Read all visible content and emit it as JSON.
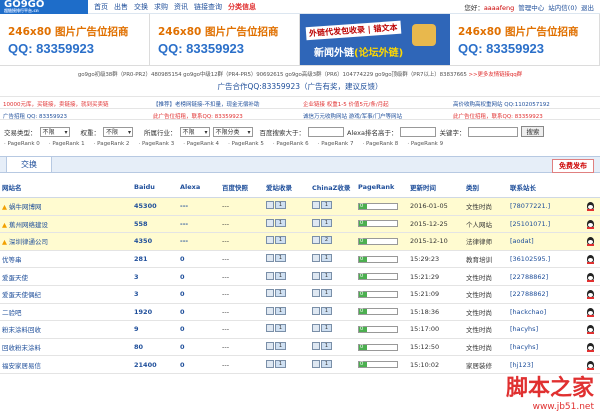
{
  "logo": {
    "text": "GO9GO",
    "sub": "超链接排行平台.cn"
  },
  "nav": [
    "首页",
    "出售",
    "交换",
    "求购",
    "资讯",
    "链接查询",
    "分类信息"
  ],
  "user": {
    "label": "您好：",
    "name": "aaaafeng",
    "center": "管理中心",
    "msg": "站内信(0)",
    "exit": "退出"
  },
  "ads": [
    {
      "title": "246x80 图片广告位招商",
      "qq": "QQ: 83359923"
    },
    {
      "title": "246x80 图片广告位招商",
      "qq": "QQ: 83359923"
    },
    {
      "line1": "外链代发包收录 | 锚文本",
      "line2": "新闻外链",
      "line2b": "(论坛外链)"
    },
    {
      "title": "246x80 图片广告位招商",
      "qq": "QQ: 83359923"
    }
  ],
  "qqgroups": "go9go初级38群（PR0-PR2）480985154  go9go中级12群（PR4-PR5）90692615  go9go高级3群（PR6）104774229  go9go顶级群（PR7以上）83837665",
  "qqmore": ">>更多友情链接qq群",
  "pr_notice": "广告合作QQ:83359923（广告有奖，建议反馈）",
  "announce1": [
    {
      "text": "10000元库，买链接，卖链接，就到买卖链",
      "cls": "red"
    },
    {
      "text": "【推荐】老榜网链接-不扣量，现金无偿补助",
      "cls": "blue"
    },
    {
      "text": "企业链接 权重1-5 价值5元/条/月起",
      "cls": "red"
    },
    {
      "text": "高价收购高权重网站 QQ:1102057192",
      "cls": "blue"
    }
  ],
  "announce2": [
    {
      "text": "广告招租 QQ: 83359923",
      "cls": "blue"
    },
    {
      "text": "此广告位招租，联系QQ: 83359923",
      "cls": "red"
    },
    {
      "text": "诚信万元收购网站 游戏/军事/门户等网站",
      "cls": "blue"
    },
    {
      "text": "此广告位招租，联系QQ: 83359923",
      "cls": "red"
    }
  ],
  "filter": {
    "type_label": "交易类型：",
    "type_val": "不限",
    "weight_label": "权重：",
    "weight_val": "不限",
    "industry_label": "所属行业：",
    "industry_val": "不限",
    "sub_label": "不限分类",
    "baidu_label": "百度搜索大于：",
    "alexa_label": "Alexa排名高于：",
    "kw_label": "关键字：",
    "search_btn": "搜索"
  },
  "pr_filters": [
    "PageRank 0",
    "PageRank 1",
    "PageRank 2",
    "PageRank 3",
    "PageRank 4",
    "PageRank 5",
    "PageRank 6",
    "PageRank 7",
    "PageRank 8",
    "PageRank 9"
  ],
  "tab": "交换",
  "free_btn": "免费发布",
  "table": {
    "headers": [
      "网站名",
      "Baidu",
      "Alexa",
      "百度快照",
      "爱站收录",
      "ChinaZ收录",
      "PageRank",
      "更新时间",
      "类别",
      "联系站长"
    ],
    "rows": [
      {
        "name": "蜗牛网博网",
        "baidu": "45300",
        "alexa": "---",
        "snap": "---",
        "az": "1",
        "cz": "1",
        "pr": "0",
        "time": "2016-01-05",
        "cat": "文性时尚",
        "contact": "[78077221.]",
        "top": true
      },
      {
        "name": "蕉州网络建设",
        "baidu": "558",
        "alexa": "---",
        "snap": "---",
        "az": "1",
        "cz": "1",
        "pr": "0",
        "time": "2015-12-25",
        "cat": "个人网站",
        "contact": "[25101071.]",
        "top": true
      },
      {
        "name": "深圳律通公司",
        "baidu": "4350",
        "alexa": "---",
        "snap": "---",
        "az": "1",
        "cz": "2",
        "pr": "0",
        "time": "2015-12-10",
        "cat": "法律律师",
        "contact": "[aodat]",
        "top": true
      },
      {
        "name": "优等串",
        "baidu": "281",
        "alexa": "0",
        "snap": "---",
        "az": "1",
        "cz": "1",
        "pr": "0",
        "time": "15:29:23",
        "cat": "教育培训",
        "contact": "[36102595.]",
        "top": false
      },
      {
        "name": "爱蛋天使",
        "baidu": "3",
        "alexa": "0",
        "snap": "---",
        "az": "1",
        "cz": "1",
        "pr": "0",
        "time": "15:21:29",
        "cat": "文性时尚",
        "contact": "[22788862]",
        "top": false
      },
      {
        "name": "爱蛋天使偶纪",
        "baidu": "3",
        "alexa": "0",
        "snap": "---",
        "az": "1",
        "cz": "1",
        "pr": "0",
        "time": "15:21:09",
        "cat": "文性时尚",
        "contact": "[22788862]",
        "top": false
      },
      {
        "name": "二验吧",
        "baidu": "1920",
        "alexa": "0",
        "snap": "---",
        "az": "1",
        "cz": "1",
        "pr": "0",
        "time": "15:18:36",
        "cat": "文性时尚",
        "contact": "[hackchao]",
        "top": false
      },
      {
        "name": "粉末涂料回收",
        "baidu": "9",
        "alexa": "0",
        "snap": "---",
        "az": "1",
        "cz": "1",
        "pr": "0",
        "time": "15:17:00",
        "cat": "文性时尚",
        "contact": "[hacyhs]",
        "top": false
      },
      {
        "name": "回收粉末涂料",
        "baidu": "80",
        "alexa": "0",
        "snap": "---",
        "az": "1",
        "cz": "1",
        "pr": "0",
        "time": "15:12:50",
        "cat": "文性时尚",
        "contact": "[hacyhs]",
        "top": false
      },
      {
        "name": "福安家居易信",
        "baidu": "21400",
        "alexa": "0",
        "snap": "---",
        "az": "1",
        "cz": "1",
        "pr": "0",
        "time": "15:10:02",
        "cat": "家居装修",
        "contact": "[hj123]",
        "top": false
      }
    ]
  },
  "watermark": {
    "a": "脚本之家",
    "b": "www.jb51.net"
  }
}
